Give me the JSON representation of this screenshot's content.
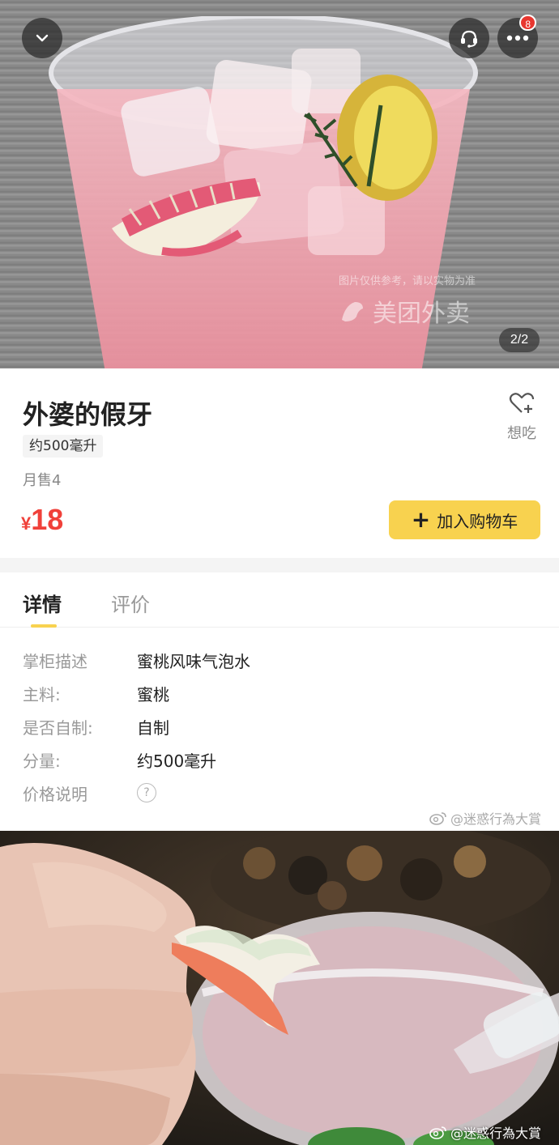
{
  "hero": {
    "counter": "2/2",
    "notification_count": "8",
    "watermark_note": "图片仅供参考，请以实物为准",
    "watermark_brand": "美团外卖",
    "icons": {
      "back": "chevron-down-icon",
      "service": "customer-service-icon",
      "more": "more-dots-icon"
    }
  },
  "product": {
    "title": "外婆的假牙",
    "spec": "约500毫升",
    "monthly_sales": "月售4",
    "price_currency": "¥",
    "price_value": "18",
    "wish_label": "想吃",
    "add_to_cart_plus": "+",
    "add_to_cart_label": "加入购物车",
    "colors": {
      "price": "#f0413a",
      "accent": "#f8d24f"
    }
  },
  "tabs": [
    {
      "label": "详情",
      "active": true
    },
    {
      "label": "评价",
      "active": false
    }
  ],
  "details": [
    {
      "key": "掌柜描述",
      "value": "蜜桃风味气泡水"
    },
    {
      "key": "主料:",
      "value": "蜜桃"
    },
    {
      "key": "是否自制:",
      "value": "自制"
    },
    {
      "key": "分量:",
      "value": "约500毫升"
    },
    {
      "key": "价格说明",
      "value": "?"
    }
  ],
  "weibo_watermark": "@迷惑行為大賞"
}
